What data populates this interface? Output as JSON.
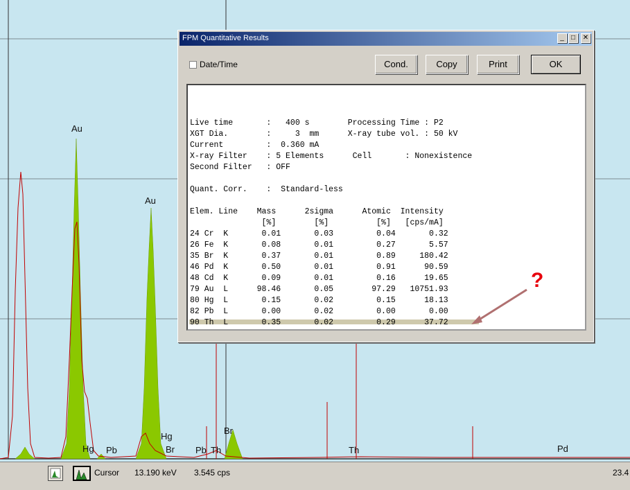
{
  "spectrum": {
    "peak_labels": [
      "Au",
      "Au",
      "Hg",
      "Pb",
      "Hg",
      "Br",
      "Pb",
      "Th",
      "Br",
      "Th",
      "Pd"
    ]
  },
  "statusbar": {
    "cursor_label": "Cursor",
    "energy": "13.190 keV",
    "count_rate": "3.545 cps",
    "right_value": "23.4"
  },
  "dialog": {
    "title": "FPM Quantitative Results",
    "datetime_label": "Date/Time",
    "buttons": {
      "cond": "Cond.",
      "copy": "Copy",
      "print": "Print",
      "ok": "OK"
    },
    "report_header": [
      "Live time       :   400 s        Processing Time : P2",
      "XGT Dia.        :     3  mm      X-ray tube vol. : 50 kV",
      "Current         :  0.360 mA",
      "X-ray Filter    : 5 Elements      Cell       : Nonexistence",
      "Second Filter   : OFF",
      "",
      "Quant. Corr.    :  Standard-less",
      "",
      "Elem. Line    Mass      2sigma      Atomic  Intensity",
      "               [%]        [%]          [%]   [cps/mA]"
    ],
    "rows": [
      [
        "24",
        "Cr",
        "K",
        "0.01",
        "0.03",
        "0.04",
        "0.32"
      ],
      [
        "26",
        "Fe",
        "K",
        "0.08",
        "0.01",
        "0.27",
        "5.57"
      ],
      [
        "35",
        "Br",
        "K",
        "0.37",
        "0.01",
        "0.89",
        "180.42"
      ],
      [
        "46",
        "Pd",
        "K",
        "0.50",
        "0.01",
        "0.91",
        "90.59"
      ],
      [
        "48",
        "Cd",
        "K",
        "0.09",
        "0.01",
        "0.16",
        "19.65"
      ],
      [
        "79",
        "Au",
        "L",
        "98.46",
        "0.05",
        "97.29",
        "10751.93"
      ],
      [
        "80",
        "Hg",
        "L",
        "0.15",
        "0.02",
        "0.15",
        "18.13"
      ],
      [
        "82",
        "Pb",
        "L",
        "0.00",
        "0.02",
        "0.00",
        "0.00"
      ],
      [
        "90",
        "Th",
        "L",
        "0.35",
        "0.02",
        "0.29",
        "37.72"
      ]
    ]
  },
  "annotation": {
    "text": "?",
    "color": "#e8000c"
  }
}
